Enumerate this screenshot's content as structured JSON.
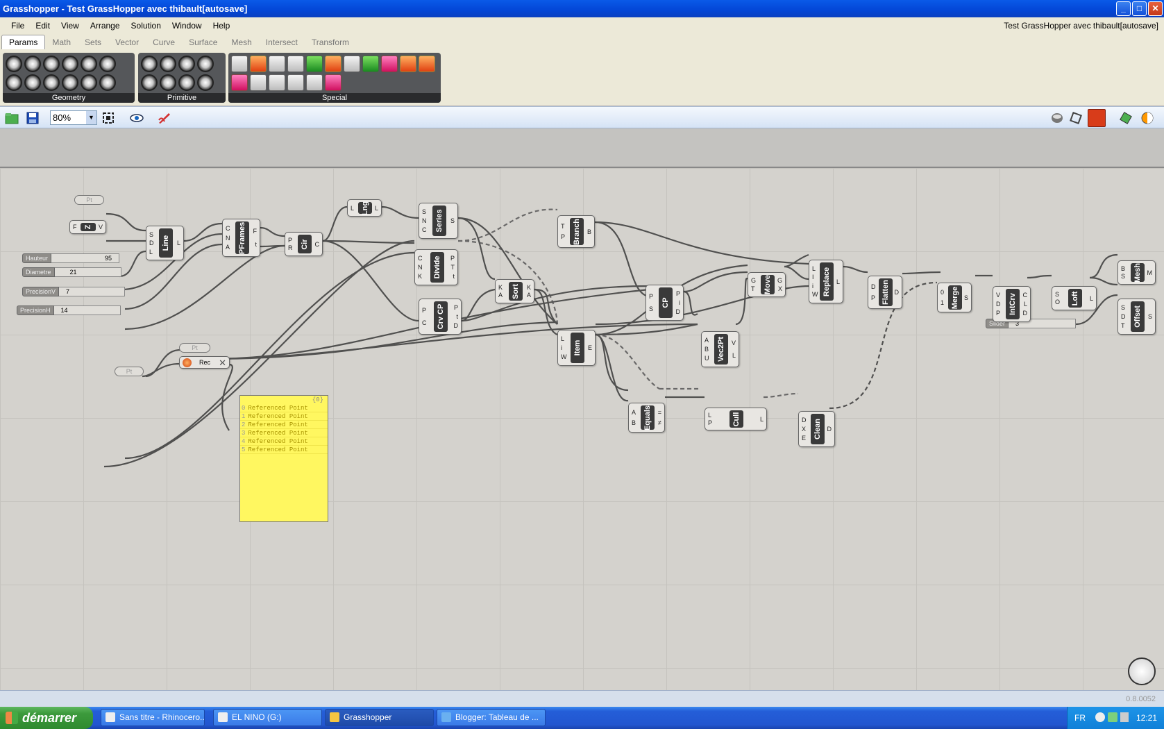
{
  "window": {
    "title": "Grasshopper - Test GrassHopper avec thibault[autosave]",
    "doc_name": "Test GrassHopper avec thibault[autosave]",
    "controls": [
      "_",
      "□",
      "✕"
    ]
  },
  "menu": [
    "File",
    "Edit",
    "View",
    "Arrange",
    "Solution",
    "Window",
    "Help"
  ],
  "tabs": [
    "Params",
    "Math",
    "Sets",
    "Vector",
    "Curve",
    "Surface",
    "Mesh",
    "Intersect",
    "Transform"
  ],
  "active_tab": "Params",
  "ribbon_groups": [
    {
      "label": "Geometry",
      "icons": 12
    },
    {
      "label": "Primitive",
      "icons": 8
    },
    {
      "label": "Special",
      "icons": 17
    }
  ],
  "toolbar": {
    "zoom": "80%",
    "icons": [
      "open-file-icon",
      "save-icon",
      "zoom-extents-icon",
      "preview-eye-icon",
      "sketch-icon"
    ],
    "right_icons": [
      "preview-shaded-icon",
      "preview-wire-icon",
      "preview-selected-icon",
      "preview-mesh-icon",
      "preview-color-icon"
    ]
  },
  "components": [
    {
      "id": "line",
      "label": "Line",
      "inputs": [
        "S",
        "D",
        "L"
      ],
      "outputs": [
        "L"
      ]
    },
    {
      "id": "pframes",
      "label": "PFrames",
      "inputs": [
        "C",
        "N",
        "A"
      ],
      "outputs": [
        "F",
        "t"
      ]
    },
    {
      "id": "cir",
      "label": "Cir",
      "inputs": [
        "P",
        "R"
      ],
      "outputs": [
        "C"
      ]
    },
    {
      "id": "lng",
      "label": "Lng",
      "inputs": [
        "L"
      ],
      "outputs": [
        "L"
      ]
    },
    {
      "id": "series",
      "label": "Series",
      "inputs": [
        "S",
        "N",
        "C"
      ],
      "outputs": [
        "S"
      ]
    },
    {
      "id": "divide",
      "label": "Divide",
      "inputs": [
        "C",
        "N",
        "K"
      ],
      "outputs": [
        "P",
        "T",
        "t"
      ]
    },
    {
      "id": "crvcp",
      "label": "Crv CP",
      "inputs": [
        "P",
        "C"
      ],
      "outputs": [
        "P",
        "t",
        "D"
      ]
    },
    {
      "id": "sort",
      "label": "Sort",
      "inputs": [
        "K",
        "A"
      ],
      "outputs": [
        "K",
        "A"
      ]
    },
    {
      "id": "branch",
      "label": "Branch",
      "inputs": [
        "T",
        "P"
      ],
      "outputs": [
        "B"
      ]
    },
    {
      "id": "item",
      "label": "Item",
      "inputs": [
        "L",
        "i",
        "W"
      ],
      "outputs": [
        "E"
      ]
    },
    {
      "id": "cp",
      "label": "CP",
      "inputs": [
        "P",
        "S"
      ],
      "outputs": [
        "P",
        "i",
        "D"
      ]
    },
    {
      "id": "move",
      "label": "Move",
      "inputs": [
        "G",
        "T"
      ],
      "outputs": [
        "G",
        "X"
      ]
    },
    {
      "id": "vec2pt",
      "label": "Vec2Pt",
      "inputs": [
        "A",
        "B",
        "U"
      ],
      "outputs": [
        "V",
        "L"
      ]
    },
    {
      "id": "equals",
      "label": "Equals",
      "inputs": [
        "A",
        "B"
      ],
      "outputs": [
        "=",
        "≠"
      ]
    },
    {
      "id": "cull",
      "label": "Cull",
      "inputs": [
        "L",
        "P"
      ],
      "outputs": [
        "L"
      ]
    },
    {
      "id": "clean",
      "label": "Clean",
      "inputs": [
        "D",
        "X",
        "E"
      ],
      "outputs": [
        "D"
      ]
    },
    {
      "id": "replace",
      "label": "Replace",
      "inputs": [
        "L",
        "I",
        "i",
        "W"
      ],
      "outputs": [
        "L"
      ]
    },
    {
      "id": "flatten",
      "label": "Flatten",
      "inputs": [
        "D",
        "P"
      ],
      "outputs": [
        "D"
      ]
    },
    {
      "id": "merge",
      "label": "Merge",
      "inputs": [
        "0",
        "1"
      ],
      "outputs": [
        "S"
      ]
    },
    {
      "id": "intcrv",
      "label": "IntCrv",
      "inputs": [
        "V",
        "D",
        "P"
      ],
      "outputs": [
        "C",
        "L",
        "D"
      ]
    },
    {
      "id": "loft",
      "label": "Loft",
      "inputs": [
        "S",
        "O"
      ],
      "outputs": [
        "L"
      ]
    },
    {
      "id": "mesh",
      "label": "Mesh",
      "inputs": [
        "B",
        "S"
      ],
      "outputs": [
        "M"
      ]
    },
    {
      "id": "offset",
      "label": "Offset",
      "inputs": [
        "S",
        "D",
        "T"
      ],
      "outputs": [
        "S"
      ]
    }
  ],
  "params": [
    {
      "id": "pt1",
      "label": "Pt"
    },
    {
      "id": "z",
      "label": "Z"
    },
    {
      "id": "pt2",
      "label": "Pt"
    },
    {
      "id": "pt3",
      "label": "Pt"
    },
    {
      "id": "rec",
      "label": "Rec"
    }
  ],
  "sliders": [
    {
      "id": "hauteur",
      "name": "Hauteur",
      "value": "95"
    },
    {
      "id": "diametre",
      "name": "Diametre",
      "value": "21"
    },
    {
      "id": "precisionv",
      "name": "PrecisionV",
      "value": "7"
    },
    {
      "id": "precisionh",
      "name": "PrecisionH",
      "value": "14"
    },
    {
      "id": "slider",
      "name": "Slider",
      "value": "3"
    }
  ],
  "panel": {
    "header": "{0}",
    "rows": [
      {
        "i": "0",
        "text": "Referenced Point"
      },
      {
        "i": "1",
        "text": "Referenced Point"
      },
      {
        "i": "2",
        "text": "Referenced Point"
      },
      {
        "i": "3",
        "text": "Referenced Point"
      },
      {
        "i": "4",
        "text": "Referenced Point"
      },
      {
        "i": "5",
        "text": "Referenced Point"
      }
    ]
  },
  "status": {
    "version": "0.8.0052"
  },
  "taskbar": {
    "start": "démarrer",
    "tasks": [
      "Sans titre - Rhinocero...",
      "EL NINO (G:)",
      "Grasshopper",
      "Blogger: Tableau de ..."
    ],
    "lang": "FR",
    "time": "12:21"
  }
}
